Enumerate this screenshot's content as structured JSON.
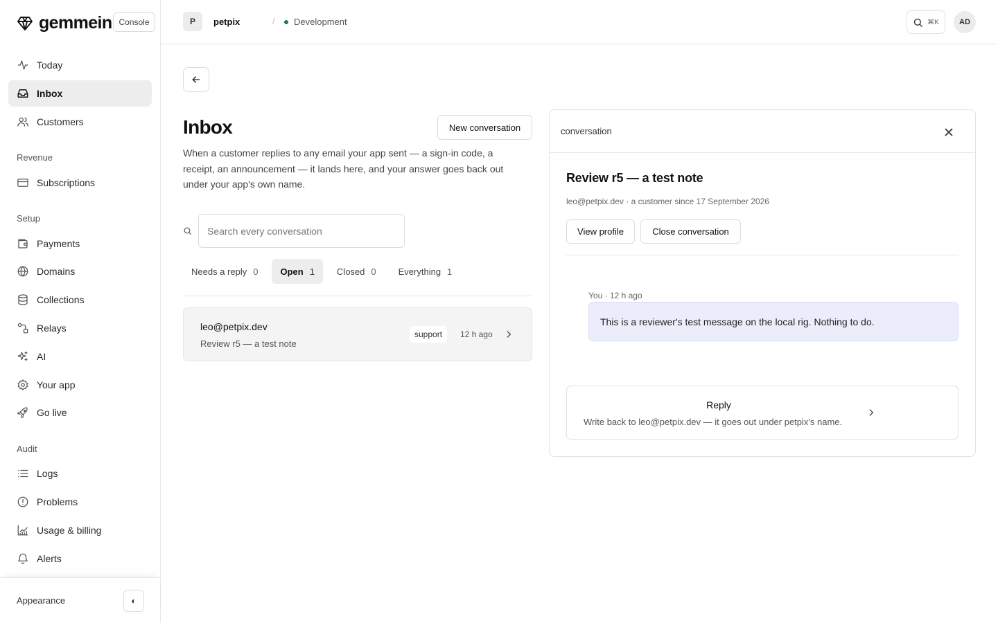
{
  "brand": {
    "name": "gemmein",
    "badge": "Console"
  },
  "sidebar": {
    "primary": [
      {
        "label": "Today",
        "icon": "activity-icon"
      },
      {
        "label": "Inbox",
        "icon": "inbox-icon",
        "active": true
      },
      {
        "label": "Customers",
        "icon": "users-icon"
      }
    ],
    "sections": [
      {
        "label": "Revenue",
        "items": [
          {
            "label": "Subscriptions",
            "icon": "credit-card-icon"
          }
        ]
      },
      {
        "label": "Setup",
        "items": [
          {
            "label": "Payments",
            "icon": "wallet-icon"
          },
          {
            "label": "Domains",
            "icon": "globe-icon"
          },
          {
            "label": "Collections",
            "icon": "database-icon"
          },
          {
            "label": "Relays",
            "icon": "relay-icon"
          },
          {
            "label": "AI",
            "icon": "sparkles-icon"
          },
          {
            "label": "Your app",
            "icon": "gear-icon"
          },
          {
            "label": "Go live",
            "icon": "rocket-icon"
          }
        ]
      },
      {
        "label": "Audit",
        "items": [
          {
            "label": "Logs",
            "icon": "list-icon"
          },
          {
            "label": "Problems",
            "icon": "alert-circle-icon"
          },
          {
            "label": "Usage & billing",
            "icon": "chart-icon"
          },
          {
            "label": "Alerts",
            "icon": "bell-icon"
          }
        ]
      }
    ],
    "footer": {
      "label": "Appearance",
      "toggle": "◐"
    }
  },
  "topbar": {
    "project_initial": "P",
    "project_name": "petpix",
    "separator": "/",
    "environment": "Development",
    "search_shortcut": "⌘K",
    "user_initials": "AD"
  },
  "main": {
    "title": "Inbox",
    "new_button": "New conversation",
    "description": "When a customer replies to any email your app sent — a sign-in code, a receipt, an announcement — it lands here, and your answer goes back out under your app's own name.",
    "search_placeholder": "Search every conversation",
    "tabs": [
      {
        "label": "Needs a reply",
        "count": "0"
      },
      {
        "label": "Open",
        "count": "1",
        "active": true
      },
      {
        "label": "Closed",
        "count": "0"
      },
      {
        "label": "Everything",
        "count": "1"
      }
    ],
    "conversations": [
      {
        "email": "leo@petpix.dev",
        "subject": "Review r5 — a test note",
        "tag": "support",
        "time": "12 h ago"
      }
    ]
  },
  "panel": {
    "header": "conversation",
    "title": "Review r5 — a test note",
    "meta": "leo@petpix.dev · a customer since 17 September 2026",
    "view_profile": "View profile",
    "close_conversation": "Close conversation",
    "message": {
      "meta": "You · 12 h ago",
      "body": "This is a reviewer's test message on the local rig. Nothing to do."
    },
    "reply": {
      "title": "Reply",
      "subtitle": "Write back to leo@petpix.dev — it goes out under petpix's name."
    }
  },
  "colors": {
    "accent_bubble": "#ebedfb",
    "active_nav": "#ededee",
    "env_dot": "#1f7a4d"
  }
}
